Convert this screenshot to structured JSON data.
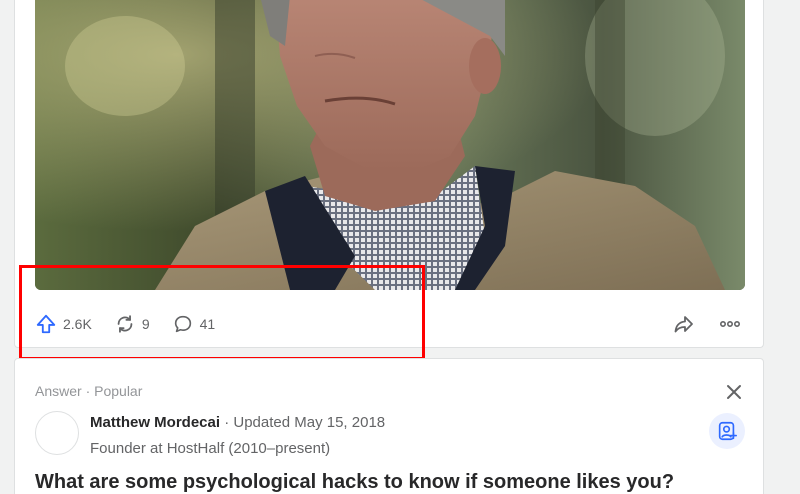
{
  "post": {
    "image_alt": "Older man with grey hair in a tan jacket and checked shirt, outdoors",
    "actions": {
      "upvote_count": "2.6K",
      "share_count": "9",
      "comment_count": "41"
    }
  },
  "next_answer": {
    "label": "Answer · Popular",
    "author_name": "Matthew Mordecai",
    "updated": " · Updated May 15, 2018",
    "credential": "Founder at HostHalf (2010–present)",
    "question": "What are some psychological hacks to know if someone likes you?"
  },
  "colors": {
    "upvote_blue": "#2e69ff",
    "highlight_red": "#ff0000",
    "text_gray": "#636466",
    "follow_bg": "#ebf0ff"
  },
  "icons": {
    "upvote": "upvote-arrow-icon",
    "reshare": "reshare-icon",
    "comment": "comment-icon",
    "share": "share-arrow-icon",
    "more": "more-dots-icon",
    "close": "close-icon",
    "follow": "follow-person-icon"
  }
}
